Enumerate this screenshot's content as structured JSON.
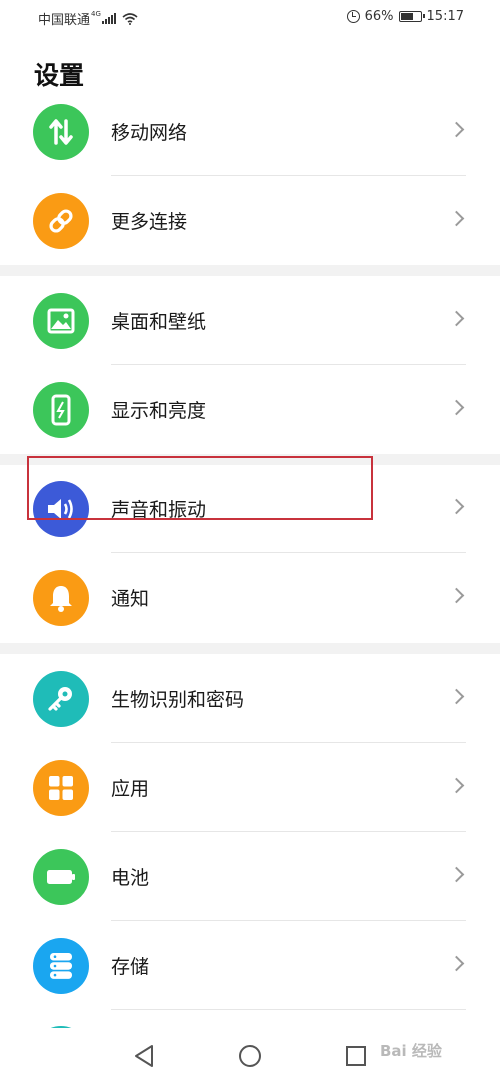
{
  "status_bar": {
    "carrier": "中国联通",
    "network": "4G",
    "battery_percent": "66%",
    "battery_level": 0.66,
    "time": "15:17",
    "icons": [
      "signal-icon",
      "wifi-icon",
      "alarm-icon",
      "battery-icon"
    ]
  },
  "header": {
    "title": "设置"
  },
  "groups": [
    {
      "items": [
        {
          "label": "移动网络",
          "icon": "mobile-data-icon",
          "color": "#3cc65a"
        },
        {
          "label": "更多连接",
          "icon": "link-icon",
          "color": "#fa9b14"
        }
      ]
    },
    {
      "items": [
        {
          "label": "桌面和壁纸",
          "icon": "image-icon",
          "color": "#3cc65a"
        },
        {
          "label": "显示和亮度",
          "icon": "phone-brightness-icon",
          "color": "#3cc65a"
        },
        {
          "label": "声音和振动",
          "icon": "speaker-icon",
          "color": "#3c5ad8",
          "highlighted": true
        },
        {
          "label": "通知",
          "icon": "bell-icon",
          "color": "#fa9b14"
        }
      ]
    },
    {
      "items": [
        {
          "label": "生物识别和密码",
          "icon": "key-icon",
          "color": "#1fbcb8"
        },
        {
          "label": "应用",
          "icon": "apps-grid-icon",
          "color": "#fa9b14"
        },
        {
          "label": "电池",
          "icon": "battery-icon",
          "color": "#3cc65a"
        },
        {
          "label": "存储",
          "icon": "storage-icon",
          "color": "#1aa6f0"
        }
      ]
    }
  ],
  "nav_bar": {
    "buttons": [
      "back-icon",
      "home-icon",
      "recent-apps-icon"
    ]
  },
  "watermark": {
    "text": "Bai 经验"
  }
}
